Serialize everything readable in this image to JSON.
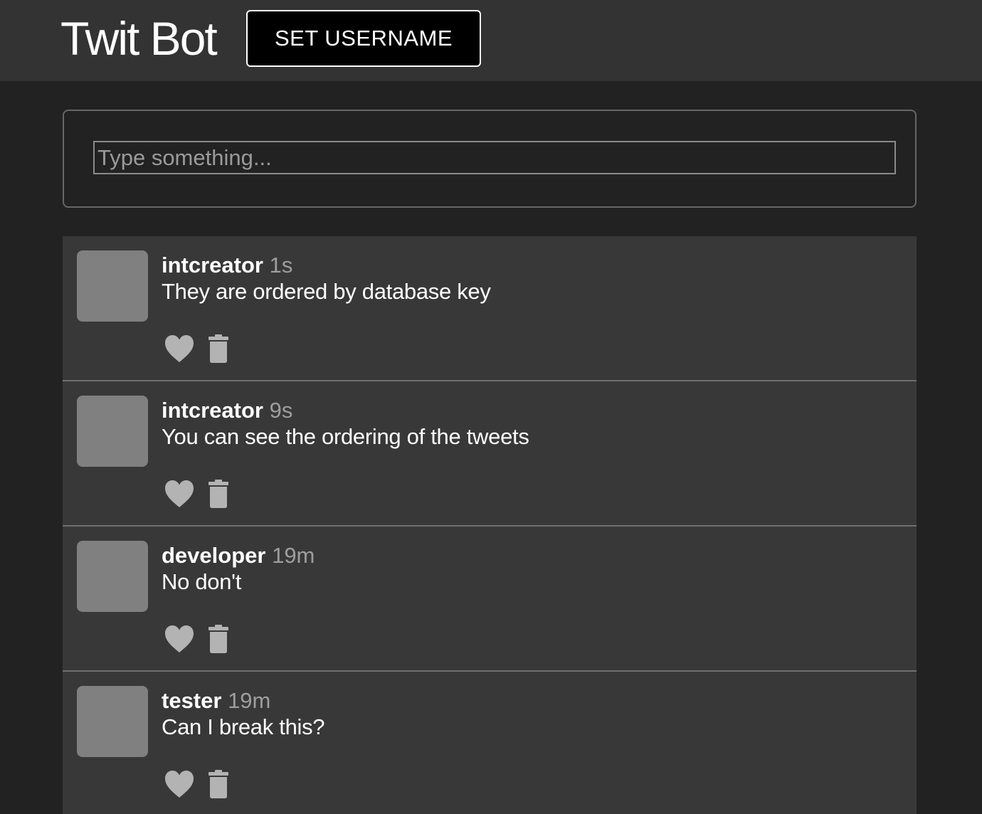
{
  "header": {
    "brand": "Twit Bot",
    "set_username_label": "SET USERNAME"
  },
  "compose": {
    "placeholder": "Type something...",
    "value": ""
  },
  "tweets": [
    {
      "username": "intcreator",
      "time": "1s",
      "text": "They are ordered by database key"
    },
    {
      "username": "intcreator",
      "time": "9s",
      "text": "You can see the ordering of the tweets"
    },
    {
      "username": "developer",
      "time": "19m",
      "text": "No don't"
    },
    {
      "username": "tester",
      "time": "19m",
      "text": "Can I break this?"
    }
  ],
  "icons": {
    "like": "heart-icon",
    "delete": "trash-icon"
  },
  "colors": {
    "header_bg": "#333333",
    "page_bg": "#222222",
    "feed_bg": "#383838",
    "avatar": "#808080",
    "icon": "#b3b3b3",
    "muted_text": "#9e9e9e"
  }
}
